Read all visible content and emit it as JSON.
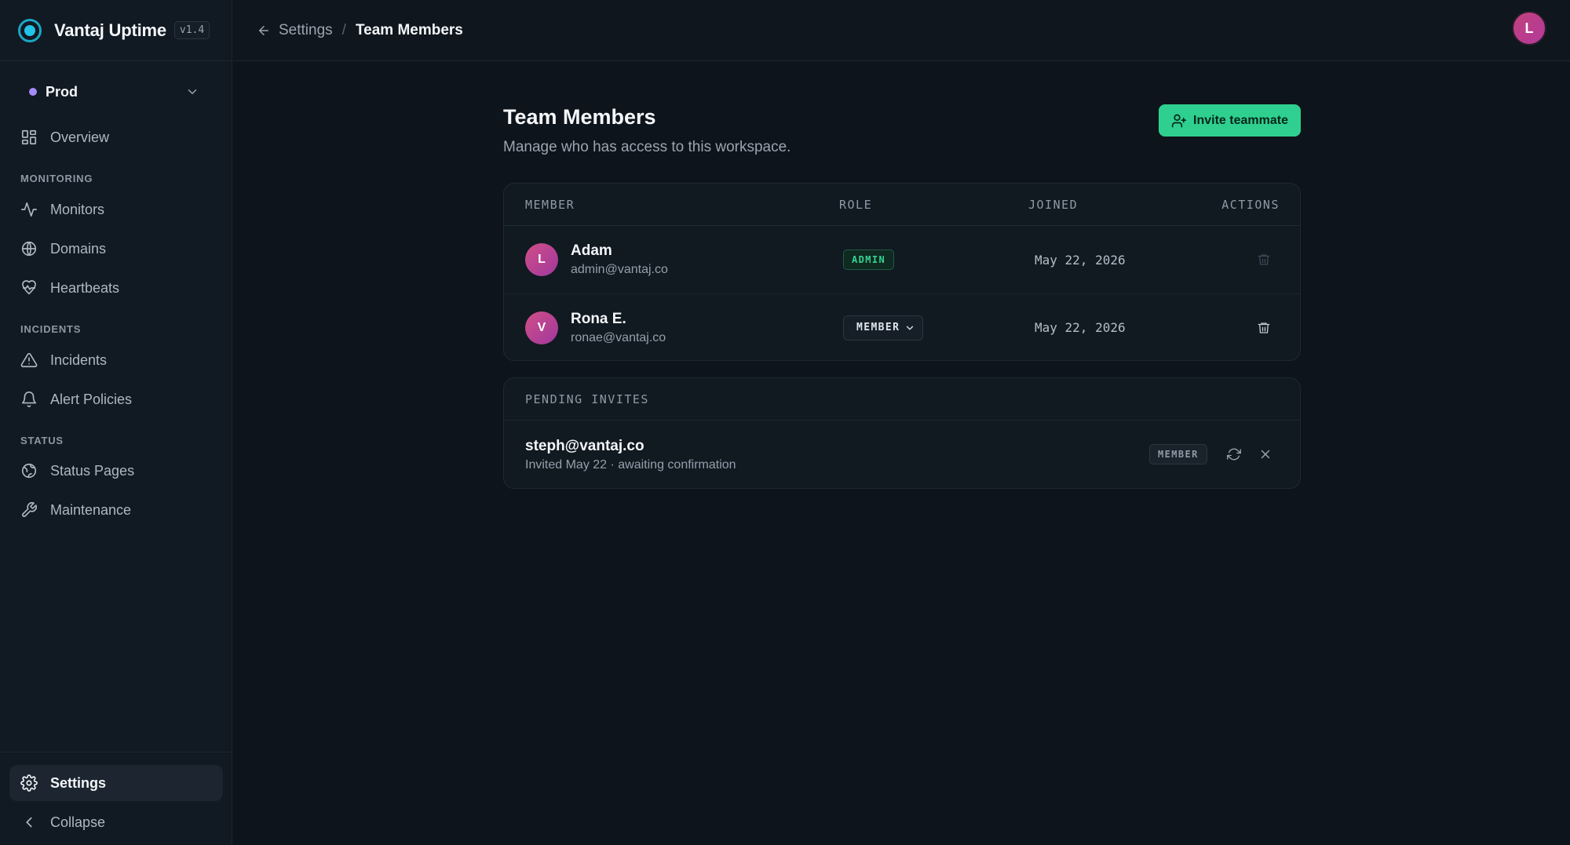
{
  "app": {
    "name": "Vantaj Uptime",
    "version": "v1.4"
  },
  "environment": {
    "name": "Prod",
    "dot_color": "#a78bfa"
  },
  "sidebar": {
    "overview": "Overview",
    "sections": {
      "monitoring": "MONITORING",
      "incidents": "INCIDENTS",
      "status": "STATUS"
    },
    "items": {
      "monitors": "Monitors",
      "domains": "Domains",
      "heartbeats": "Heartbeats",
      "incidents": "Incidents",
      "alert_policies": "Alert Policies",
      "status_pages": "Status Pages",
      "maintenance": "Maintenance"
    },
    "settings": "Settings",
    "collapse": "Collapse"
  },
  "topbar": {
    "breadcrumb": {
      "parent": "Settings",
      "separator": "/",
      "current": "Team Members"
    },
    "avatar_initial": "L"
  },
  "page": {
    "title": "Team Members",
    "subtitle": "Manage who has access to this workspace.",
    "invite_button": "Invite teammate"
  },
  "members_table": {
    "headers": {
      "member": "MEMBER",
      "role": "ROLE",
      "joined": "JOINED",
      "actions": "ACTIONS"
    },
    "rows": [
      {
        "initial": "L",
        "name": "Adam",
        "email": "admin@vantaj.co",
        "role": "ADMIN",
        "joined": "May 22, 2026"
      },
      {
        "initial": "V",
        "name": "Rona E.",
        "email": "ronae@vantaj.co",
        "role": "MEMBER",
        "joined": "May 22, 2026"
      }
    ]
  },
  "pending": {
    "header": "PENDING INVITES",
    "invites": [
      {
        "email": "steph@vantaj.co",
        "info": "Invited May 22 · awaiting confirmation",
        "role": "MEMBER"
      }
    ]
  },
  "colors": {
    "accent": "#2fd08f",
    "background": "#0e141b",
    "sidebar": "#111922",
    "avatar": "#c2417b"
  }
}
